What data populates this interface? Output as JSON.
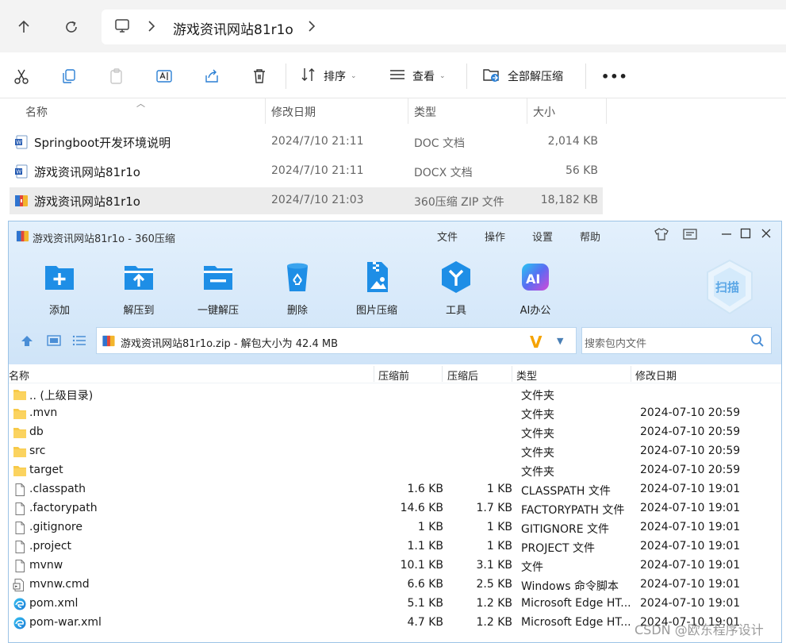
{
  "explorer": {
    "address": {
      "folder": "游戏资讯网站81r1o"
    },
    "toolbar": {
      "sort_label": "排序",
      "view_label": "查看",
      "extract_label": "全部解压缩",
      "more_label": "•••"
    },
    "columns": {
      "name": "名称",
      "date": "修改日期",
      "type": "类型",
      "size": "大小"
    },
    "files": [
      {
        "name": "Springboot开发环境说明",
        "date": "2024/7/10 21:11",
        "type": "DOC 文档",
        "size": "2,014 KB",
        "icon": "word-doc-icon"
      },
      {
        "name": "游戏资讯网站81r1o",
        "date": "2024/7/10 21:11",
        "type": "DOCX 文档",
        "size": "56 KB",
        "icon": "word-docx-icon"
      },
      {
        "name": "游戏资讯网站81r1o",
        "date": "2024/7/10 21:03",
        "type": "360压缩 ZIP 文件",
        "size": "18,182 KB",
        "icon": "zip-archive-icon"
      }
    ]
  },
  "zipwin": {
    "title": "游戏资讯网站81r1o - 360压缩",
    "menu": [
      "文件",
      "操作",
      "设置",
      "帮助"
    ],
    "tools": [
      {
        "label": "添加",
        "icon": "add-icon"
      },
      {
        "label": "解压到",
        "icon": "extract-to-icon"
      },
      {
        "label": "一键解压",
        "icon": "one-click-extract-icon"
      },
      {
        "label": "删除",
        "icon": "delete-icon"
      },
      {
        "label": "图片压缩",
        "icon": "image-compress-icon"
      },
      {
        "label": "工具",
        "icon": "tools-icon"
      },
      {
        "label": "AI办公",
        "icon": "ai-office-icon"
      }
    ],
    "scan_label": "扫描",
    "path": "游戏资讯网站81r1o.zip - 解包大小为 42.4 MB",
    "search_placeholder": "搜索包内文件",
    "columns": {
      "name": "名称",
      "before": "压缩前",
      "after": "压缩后",
      "type": "类型",
      "date": "修改日期"
    },
    "entries": [
      {
        "name": ".. (上级目录)",
        "before": "",
        "after": "",
        "type": "文件夹",
        "date": "",
        "kind": "folder"
      },
      {
        "name": ".mvn",
        "before": "",
        "after": "",
        "type": "文件夹",
        "date": "2024-07-10 20:59",
        "kind": "folder"
      },
      {
        "name": "db",
        "before": "",
        "after": "",
        "type": "文件夹",
        "date": "2024-07-10 20:59",
        "kind": "folder"
      },
      {
        "name": "src",
        "before": "",
        "after": "",
        "type": "文件夹",
        "date": "2024-07-10 20:59",
        "kind": "folder"
      },
      {
        "name": "target",
        "before": "",
        "after": "",
        "type": "文件夹",
        "date": "2024-07-10 20:59",
        "kind": "folder"
      },
      {
        "name": ".classpath",
        "before": "1.6 KB",
        "after": "1 KB",
        "type": "CLASSPATH 文件",
        "date": "2024-07-10 19:01",
        "kind": "file"
      },
      {
        "name": ".factorypath",
        "before": "14.6 KB",
        "after": "1.7 KB",
        "type": "FACTORYPATH 文件",
        "date": "2024-07-10 19:01",
        "kind": "file"
      },
      {
        "name": ".gitignore",
        "before": "1 KB",
        "after": "1 KB",
        "type": "GITIGNORE 文件",
        "date": "2024-07-10 19:01",
        "kind": "file"
      },
      {
        "name": ".project",
        "before": "1.1 KB",
        "after": "1 KB",
        "type": "PROJECT 文件",
        "date": "2024-07-10 19:01",
        "kind": "file"
      },
      {
        "name": "mvnw",
        "before": "10.1 KB",
        "after": "3.1 KB",
        "type": "文件",
        "date": "2024-07-10 19:01",
        "kind": "file"
      },
      {
        "name": "mvnw.cmd",
        "before": "6.6 KB",
        "after": "2.5 KB",
        "type": "Windows 命令脚本",
        "date": "2024-07-10 19:01",
        "kind": "cmd"
      },
      {
        "name": "pom.xml",
        "before": "5.1 KB",
        "after": "1.2 KB",
        "type": "Microsoft Edge HT...",
        "date": "2024-07-10 19:01",
        "kind": "edge"
      },
      {
        "name": "pom-war.xml",
        "before": "4.7 KB",
        "after": "1.2 KB",
        "type": "Microsoft Edge HT...",
        "date": "2024-07-10 19:01",
        "kind": "edge"
      }
    ]
  },
  "watermark": "CSDN @欧东程序设计",
  "colors": {
    "accent": "#1e8ee6",
    "folder": "#f7c948",
    "selected_row": "#ececec",
    "zip_header": "#d6e8f9"
  }
}
